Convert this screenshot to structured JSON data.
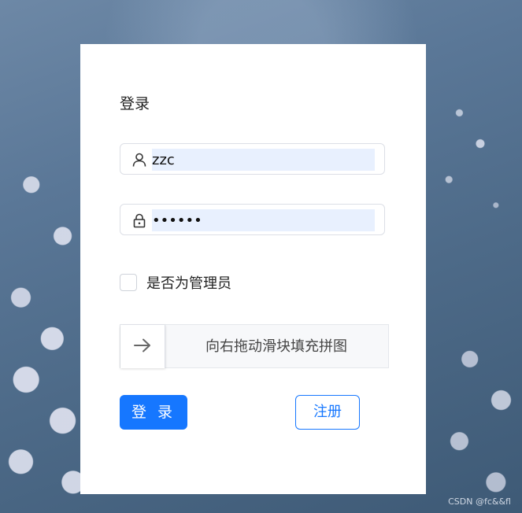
{
  "form": {
    "title": "登录",
    "username_value": "zzc",
    "password_value": "••••••",
    "admin_checkbox_label": "是否为管理员",
    "admin_checked": false,
    "slider_text": "向右拖动滑块填充拼图",
    "slider_arrow_icon": "arrow-right-icon",
    "login_button": "登 录",
    "register_button": "注册"
  },
  "icons": {
    "username": "user-icon",
    "password": "lock-icon"
  },
  "colors": {
    "primary": "#1677ff",
    "autofill_bg": "#e8f0fe",
    "card_bg": "#ffffff"
  },
  "watermark": "CSDN @fc&&fl"
}
